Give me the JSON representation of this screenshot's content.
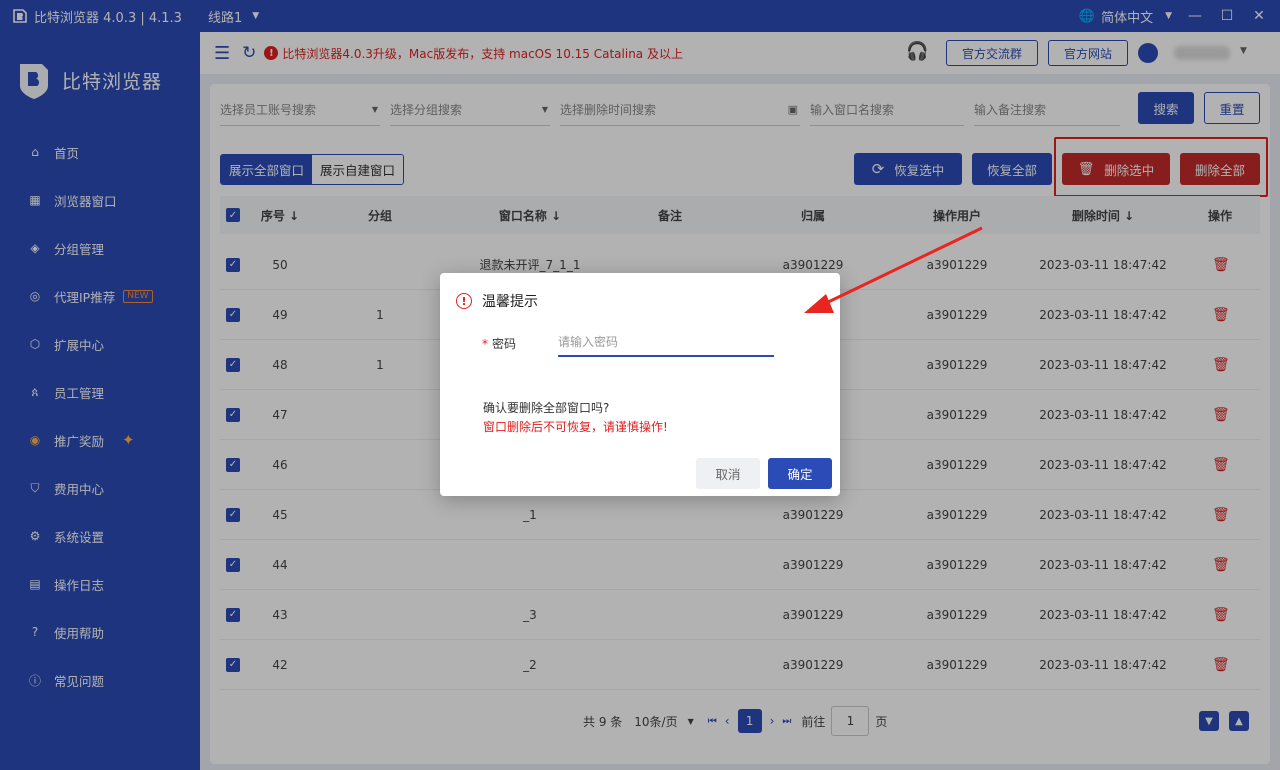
{
  "titlebar": {
    "title": "比特浏览器 4.0.3 | 4.1.3",
    "route": "线路1",
    "language": "简体中文",
    "minimize": "—",
    "maximize": "☐",
    "close": "✕"
  },
  "sidebar": {
    "brand": "比特浏览器",
    "items": [
      {
        "label": "首页",
        "icon": "home-icon"
      },
      {
        "label": "浏览器窗口",
        "icon": "grid-icon"
      },
      {
        "label": "分组管理",
        "icon": "layers-icon"
      },
      {
        "label": "代理IP推荐",
        "icon": "location-icon",
        "badge": "NEW"
      },
      {
        "label": "扩展中心",
        "icon": "cube-icon"
      },
      {
        "label": "员工管理",
        "icon": "users-icon"
      },
      {
        "label": "推广奖励",
        "icon": "coin-icon"
      },
      {
        "label": "费用中心",
        "icon": "shield-yen-icon"
      },
      {
        "label": "系统设置",
        "icon": "gear-icon"
      },
      {
        "label": "操作日志",
        "icon": "log-icon"
      },
      {
        "label": "使用帮助",
        "icon": "help-icon"
      },
      {
        "label": "常见问题",
        "icon": "info-icon"
      }
    ]
  },
  "topbar": {
    "notice": "比特浏览器4.0.3升级，Mac版发布，支持 macOS 10.15 Catalina 及以上",
    "community_btn": "官方交流群",
    "website_btn": "官方网站"
  },
  "filters": {
    "employee_placeholder": "选择员工账号搜索",
    "group_placeholder": "选择分组搜索",
    "time_placeholder": "选择删除时间搜索",
    "window_name_placeholder": "输入窗口名搜索",
    "remark_placeholder": "输入备注搜索",
    "search_btn": "搜索",
    "reset_btn": "重置"
  },
  "toolbar": {
    "show_all": "展示全部窗口",
    "show_self": "展示自建窗口",
    "restore_selected": "恢复选中",
    "restore_all": "恢复全部",
    "delete_selected": "删除选中",
    "delete_all": "删除全部"
  },
  "table": {
    "headers": {
      "seq": "序号 ↓",
      "group": "分组",
      "name": "窗口名称 ↓",
      "remark": "备注",
      "owner": "归属",
      "operator": "操作用户",
      "deleted_at": "删除时间 ↓",
      "action": "操作"
    },
    "rows": [
      {
        "seq": "50",
        "group": "",
        "name": "退款未开评_7_1_1",
        "owner": "a3901229",
        "operator": "a3901229",
        "time": "2023-03-11 18:47:42"
      },
      {
        "seq": "49",
        "group": "1",
        "name": "",
        "owner": "",
        "operator": "a3901229",
        "time": "2023-03-11 18:47:42"
      },
      {
        "seq": "48",
        "group": "1",
        "name": "",
        "owner": "",
        "operator": "a3901229",
        "time": "2023-03-11 18:47:42"
      },
      {
        "seq": "47",
        "group": "",
        "name": "",
        "owner": "",
        "operator": "a3901229",
        "time": "2023-03-11 18:47:42"
      },
      {
        "seq": "46",
        "group": "",
        "name": "",
        "owner": "",
        "operator": "a3901229",
        "time": "2023-03-11 18:47:42"
      },
      {
        "seq": "45",
        "group": "",
        "name": "_1",
        "owner": "a3901229",
        "operator": "a3901229",
        "time": "2023-03-11 18:47:42"
      },
      {
        "seq": "44",
        "group": "",
        "name": "",
        "owner": "a3901229",
        "operator": "a3901229",
        "time": "2023-03-11 18:47:42"
      },
      {
        "seq": "43",
        "group": "",
        "name": "_3",
        "owner": "a3901229",
        "operator": "a3901229",
        "time": "2023-03-11 18:47:42"
      },
      {
        "seq": "42",
        "group": "",
        "name": "_2",
        "owner": "a3901229",
        "operator": "a3901229",
        "time": "2023-03-11 18:47:42"
      }
    ]
  },
  "pagination": {
    "total": "共 9 条",
    "page_size": "10条/页",
    "current": "1",
    "goto_label": "前往",
    "goto_value": "1",
    "page_unit": "页"
  },
  "dialog": {
    "title": "温馨提示",
    "password_label": "密码",
    "password_placeholder": "请输入密码",
    "confirm_message": "确认要删除全部窗口吗?",
    "warning_message": "窗口删除后不可恢复，请谨慎操作!",
    "cancel": "取消",
    "ok": "确定"
  },
  "colors": {
    "brand_blue": "#2b4bb6",
    "danger_red": "#c22a2a",
    "warning_text": "#e02020"
  }
}
